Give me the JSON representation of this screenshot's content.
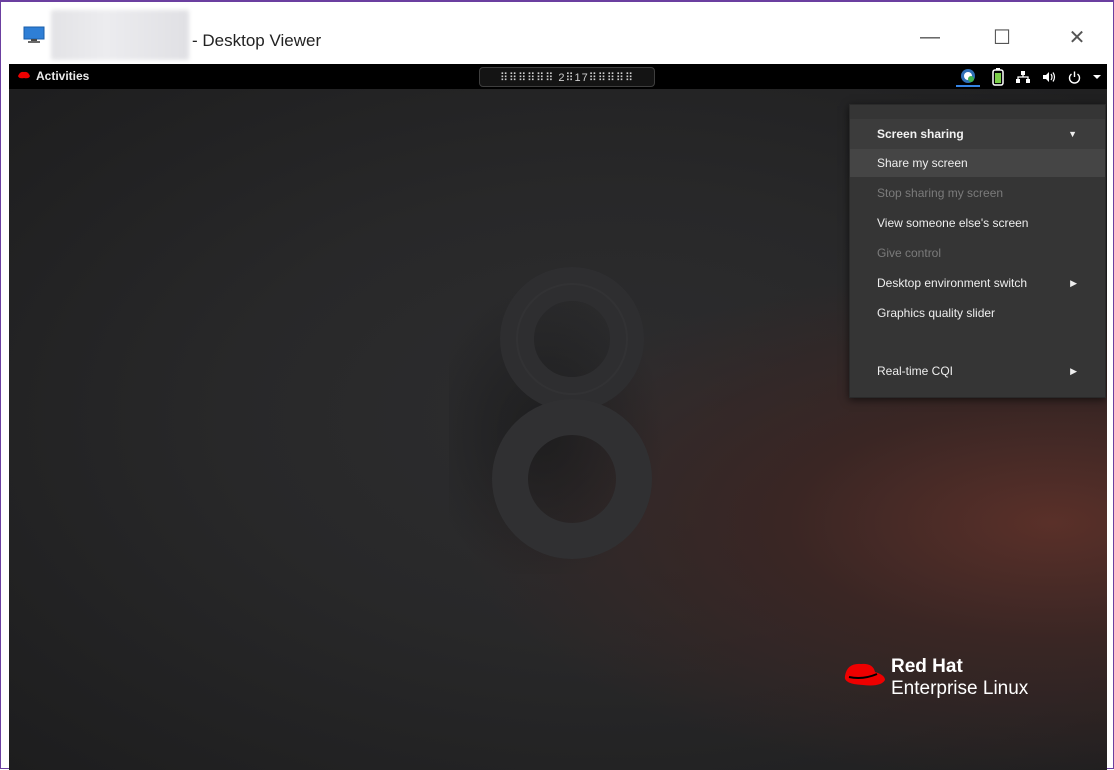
{
  "window": {
    "title": "- Desktop Viewer",
    "controls": {
      "minimize": "—",
      "maximize": "☐",
      "close": "✕"
    }
  },
  "topbar": {
    "activities_label": "Activities",
    "clock_text": "⠿⠿⠿⠿⠿⠿ 2⠿17⠿⠿⠿⠿⠿",
    "tray_icons": [
      "citrix-workspace-icon",
      "battery-icon",
      "network-icon",
      "volume-icon",
      "power-icon",
      "chevron-down-icon"
    ]
  },
  "menu": {
    "header": "Screen sharing",
    "items": [
      {
        "label": "Share my screen",
        "enabled": true,
        "submenu": false
      },
      {
        "label": "Stop sharing my screen",
        "enabled": false,
        "submenu": false
      },
      {
        "label": "View someone else's screen",
        "enabled": true,
        "submenu": false
      },
      {
        "label": "Give control",
        "enabled": false,
        "submenu": false
      },
      {
        "label": "Desktop environment switch",
        "enabled": true,
        "submenu": true
      },
      {
        "label": "Graphics quality slider",
        "enabled": true,
        "submenu": false
      },
      {
        "label": "Real-time CQI",
        "enabled": true,
        "submenu": true
      }
    ]
  },
  "branding": {
    "line1": "Red Hat",
    "line2": "Enterprise Linux"
  },
  "colors": {
    "accent": "#6b3fa0",
    "redhat_red": "#ee0000",
    "desktop_bg": "#282829",
    "menu_bg": "#353535"
  }
}
